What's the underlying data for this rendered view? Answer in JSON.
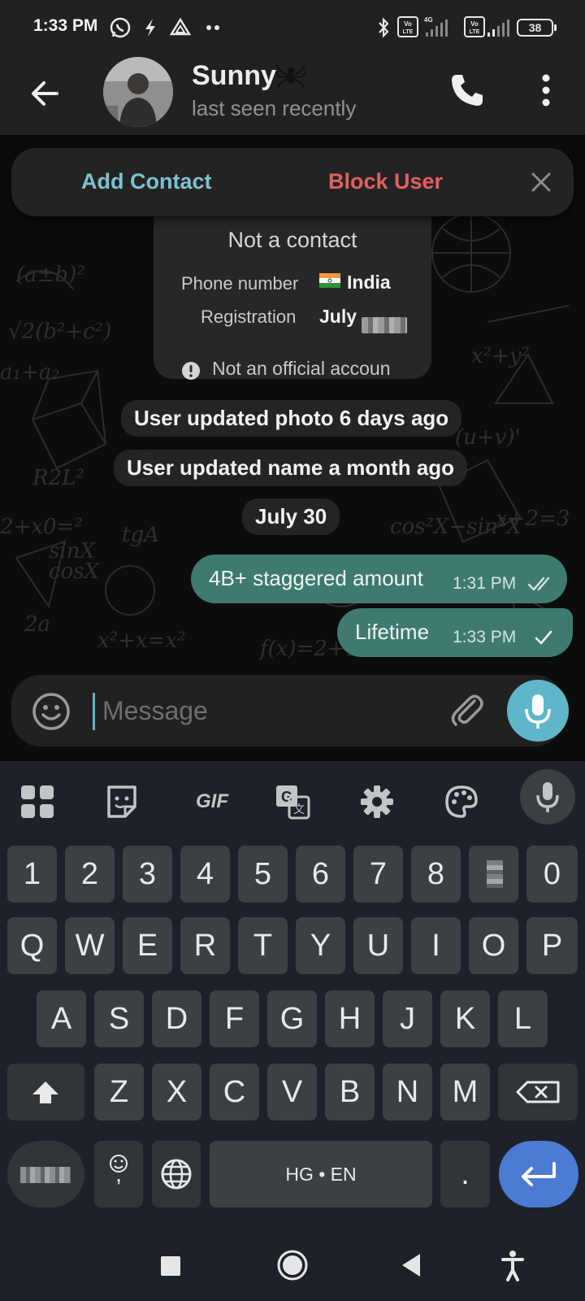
{
  "status_bar": {
    "time": "1:33 PM",
    "battery": "38"
  },
  "header": {
    "name": "Sunny",
    "status": "last seen recently"
  },
  "action_bar": {
    "add_contact": "Add Contact",
    "block_user": "Block User"
  },
  "info_card": {
    "title": "Not a contact",
    "phone_label": "Phone number",
    "phone_value": "India",
    "registration_label": "Registration",
    "registration_value": "July",
    "notice": "Not an official accoun"
  },
  "service_messages": [
    "User updated photo 6 days ago",
    "User updated name a month ago",
    "July 30"
  ],
  "messages": [
    {
      "text": "4B+ staggered amount",
      "time": "1:31 PM",
      "status": "read"
    },
    {
      "text": "Lifetime",
      "time": "1:33 PM",
      "status": "sent"
    }
  ],
  "input": {
    "placeholder": "Message"
  },
  "keyboard": {
    "tools": [
      "apps-icon",
      "sticker-icon",
      "gif-icon",
      "translate-icon",
      "settings-icon",
      "palette-icon",
      "mic-icon"
    ],
    "gif_label": "GIF",
    "number_row": [
      "1",
      "2",
      "3",
      "4",
      "5",
      "6",
      "7",
      "8",
      "",
      "0"
    ],
    "row1": [
      "Q",
      "W",
      "E",
      "R",
      "T",
      "Y",
      "U",
      "I",
      "O",
      "P"
    ],
    "row2": [
      "A",
      "S",
      "D",
      "F",
      "G",
      "H",
      "J",
      "K",
      "L"
    ],
    "row3": [
      "Z",
      "X",
      "C",
      "V",
      "B",
      "N",
      "M"
    ],
    "comma": ",",
    "space": "HG • EN",
    "period": "."
  },
  "colors": {
    "accent": "#5fb6c9",
    "bubble": "#3f7a70",
    "block": "#e0605f",
    "add": "#7ec1d0",
    "enter": "#4c7bd4"
  }
}
